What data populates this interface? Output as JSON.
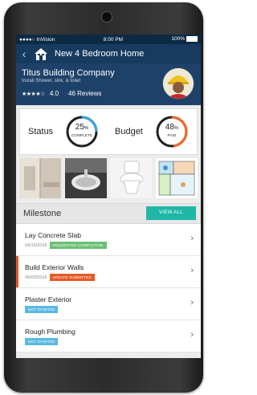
{
  "status_bar": {
    "carrier": "●●●●○ InVision",
    "time": "8:00 PM",
    "battery": "100%"
  },
  "nav": {
    "back_icon": "chevron-left-icon",
    "home_icon": "house-icon",
    "title": "New 4 Bedroom Home"
  },
  "company": {
    "name": "Titus Building Company",
    "subtitle": "Install Shower, sink, & toilet",
    "stars": "★★★★☆",
    "rating": "4.0",
    "reviews": "46 Reviews"
  },
  "stats": {
    "status_label": "Status",
    "status_value": "25",
    "status_unit": "%",
    "status_sub": "COMPLETE",
    "status_fraction": 0.25,
    "budget_label": "Budget",
    "budget_value": "48",
    "budget_unit": "%",
    "budget_sub": "PAID",
    "budget_fraction": 0.48
  },
  "colors": {
    "navy": "#163a60",
    "status_ring": "#3aa0dc",
    "budget_ring": "#ee6a2c",
    "teal": "#20b6a7",
    "green_badge": "#6abf72",
    "orange_badge": "#e55a26",
    "blue_badge": "#5ab8e4"
  },
  "milestones": {
    "title": "Milestone",
    "view_all": "VIEW ALL",
    "items": [
      {
        "title": "Lay Concrete Slab",
        "date": "04/15/2016",
        "badge": "REQUESTED COMPLETION",
        "badge_color": "#6abf72",
        "accent": ""
      },
      {
        "title": "Build Exterior Walls",
        "date": "05/03/2016",
        "badge": "UPDATE SUBMITTED",
        "badge_color": "#e55a26",
        "accent": "#e55a26"
      },
      {
        "title": "Plaster Exterior",
        "date": "",
        "badge": "NOT STARTED",
        "badge_color": "#5ab8e4",
        "accent": ""
      },
      {
        "title": "Rough Plumbing",
        "date": "",
        "badge": "NOT STARTED",
        "badge_color": "#5ab8e4",
        "accent": ""
      }
    ]
  }
}
